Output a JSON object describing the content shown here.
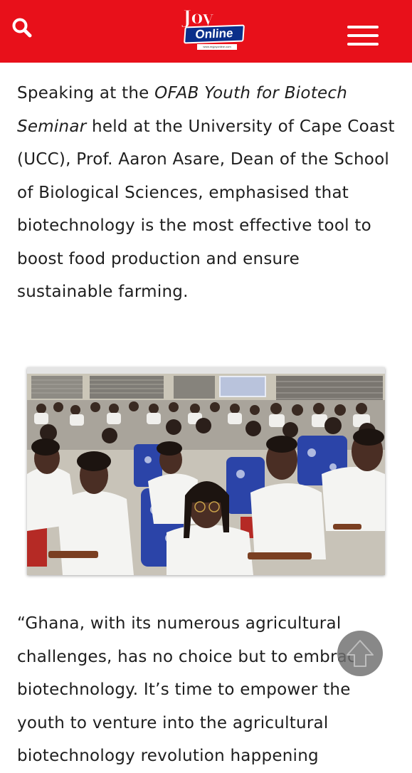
{
  "header": {
    "background": "#e8101a",
    "search_icon": "search-icon",
    "menu_icon": "hamburger-menu-icon",
    "logo": {
      "word1": "Joy",
      "word2": "Online",
      "tagline": "www.myjoyonline.com"
    }
  },
  "article": {
    "p1": {
      "lead": "Speaking at the ",
      "event": "OFAB Youth for Biotech Seminar",
      "rest": " held at the University of Cape Coast (UCC), Prof. Aaron Asare, Dean of the School of Biological Sciences, emphasised that biotechnology is the most effective tool to boost food production and ensure sustainable farming."
    },
    "photo": {
      "description_icon": "seminar-photo"
    },
    "p2": "“Ghana, with its numerous agricultural challenges, has no choice but to embrace biotechnology. It’s time to empower the youth to venture into the agricultural biotechnology revolution happening"
  },
  "scroll_top": {
    "icon": "arrow-up-icon"
  }
}
